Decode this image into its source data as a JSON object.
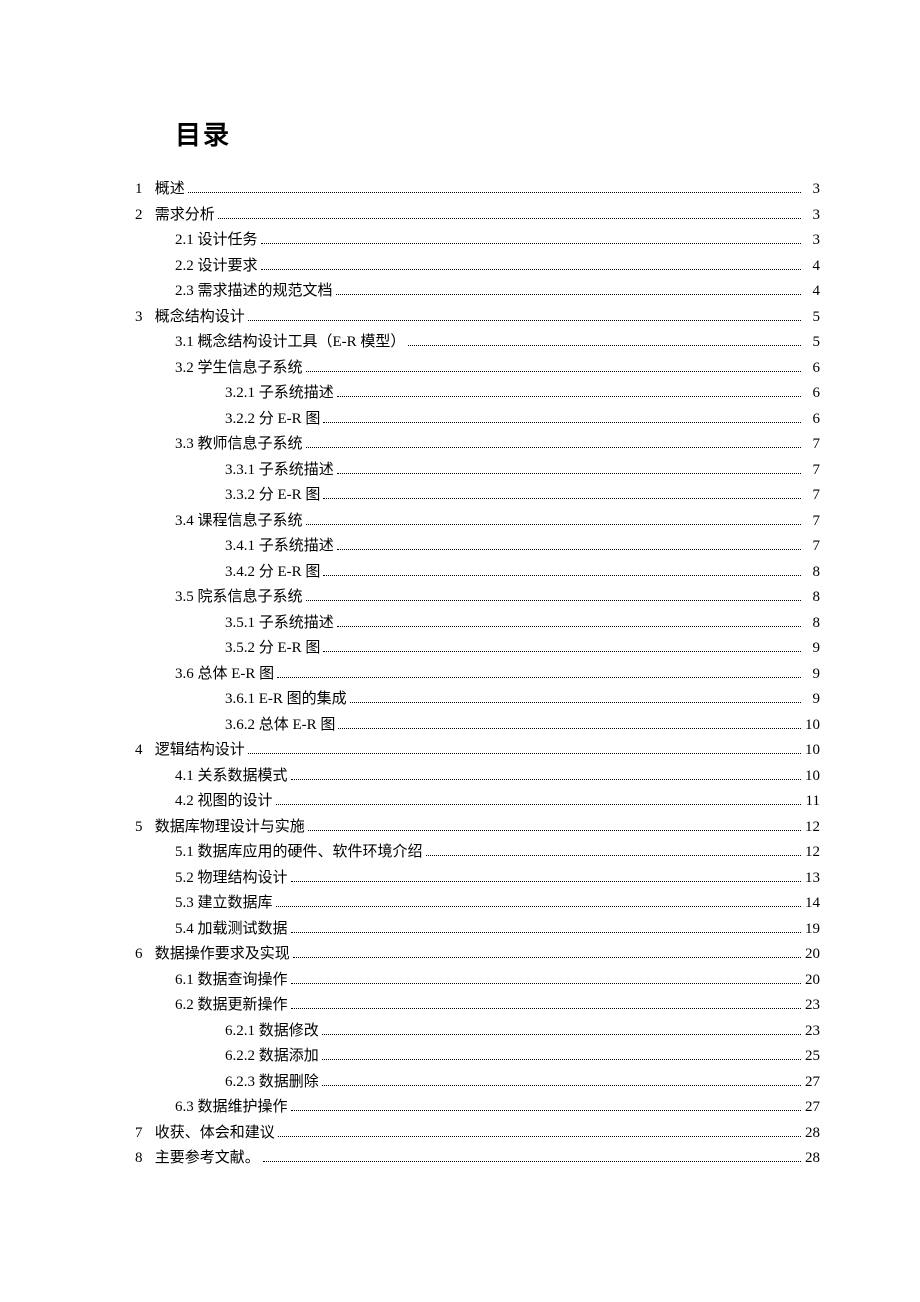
{
  "title": "目录",
  "toc": [
    {
      "level": 1,
      "num": "1",
      "sep": "  ",
      "text": "概述",
      "page": "3"
    },
    {
      "level": 1,
      "num": "2",
      "sep": "  ",
      "text": "需求分析",
      "page": "3"
    },
    {
      "level": 2,
      "num": "2.1",
      "sep": "  ",
      "text": "设计任务",
      "page": "3"
    },
    {
      "level": 2,
      "num": "2.2",
      "sep": "  ",
      "text": "设计要求",
      "page": "4"
    },
    {
      "level": 2,
      "num": "2.3",
      "sep": "  ",
      "text": "需求描述的规范文档",
      "page": "4"
    },
    {
      "level": 1,
      "num": "3",
      "sep": "  ",
      "text": "概念结构设计",
      "page": "5"
    },
    {
      "level": 2,
      "num": "3.1",
      "sep": "  ",
      "text": "概念结构设计工具（E-R 模型）",
      "page": "5"
    },
    {
      "level": 2,
      "num": "3.2",
      "sep": "  ",
      "text": "学生信息子系统",
      "page": "6"
    },
    {
      "level": 3,
      "num": "3.2.1",
      "sep": " ",
      "text": "子系统描述",
      "page": "6"
    },
    {
      "level": 3,
      "num": "3.2.2",
      "sep": " ",
      "text": "分 E-R 图",
      "page": "6"
    },
    {
      "level": 2,
      "num": "3.3",
      "sep": " ",
      "text": "教师信息子系统",
      "page": "7"
    },
    {
      "level": 3,
      "num": "3.3.1",
      "sep": " ",
      "text": "子系统描述",
      "page": "7"
    },
    {
      "level": 3,
      "num": "3.3.2",
      "sep": " ",
      "text": "分 E-R 图",
      "page": "7"
    },
    {
      "level": 2,
      "num": "3.4",
      "sep": "  ",
      "text": "课程信息子系统",
      "page": "7"
    },
    {
      "level": 3,
      "num": "3.4.1",
      "sep": " ",
      "text": "子系统描述",
      "page": "7"
    },
    {
      "level": 3,
      "num": "3.4.2",
      "sep": " ",
      "text": "分 E-R 图",
      "page": "8"
    },
    {
      "level": 2,
      "num": "3.5",
      "sep": "  ",
      "text": "院系信息子系统",
      "page": "8"
    },
    {
      "level": 3,
      "num": "3.5.1",
      "sep": " ",
      "text": "子系统描述",
      "page": "8"
    },
    {
      "level": 3,
      "num": "3.5.2",
      "sep": " ",
      "text": "分 E-R 图",
      "page": "9"
    },
    {
      "level": 2,
      "num": "3.6",
      "sep": "  ",
      "text": "总体 E-R 图",
      "page": "9"
    },
    {
      "level": 3,
      "num": "3.6.1",
      "sep": " ",
      "text": "E-R 图的集成",
      "page": "9"
    },
    {
      "level": 3,
      "num": "3.6.2",
      "sep": " ",
      "text": "总体 E-R 图",
      "page": "10"
    },
    {
      "level": 1,
      "num": "4",
      "sep": "  ",
      "text": "逻辑结构设计",
      "page": "10"
    },
    {
      "level": 2,
      "num": "4.1",
      "sep": "  ",
      "text": "关系数据模式",
      "page": "10"
    },
    {
      "level": 2,
      "num": "4.2",
      "sep": "  ",
      "text": "视图的设计",
      "page": "11"
    },
    {
      "level": 1,
      "num": "5",
      "sep": "  ",
      "text": "数据库物理设计与实施",
      "page": "12"
    },
    {
      "level": 2,
      "num": "5.1",
      "sep": "  ",
      "text": "数据库应用的硬件、软件环境介绍",
      "page": "12"
    },
    {
      "level": 2,
      "num": "5.2",
      "sep": "  ",
      "text": "物理结构设计",
      "page": "13"
    },
    {
      "level": 2,
      "num": "5.3",
      "sep": "  ",
      "text": "建立数据库",
      "page": "14"
    },
    {
      "level": 2,
      "num": "5.4",
      "sep": "  ",
      "text": "加载测试数据",
      "page": "19"
    },
    {
      "level": 1,
      "num": "6",
      "sep": "  ",
      "text": "数据操作要求及实现",
      "page": "20"
    },
    {
      "level": 2,
      "num": "6.1",
      "sep": "  ",
      "text": "数据查询操作",
      "page": "20"
    },
    {
      "level": 2,
      "num": "6.2",
      "sep": "  ",
      "text": "数据更新操作",
      "page": "23"
    },
    {
      "level": 3,
      "num": "6.2.1",
      "sep": "  ",
      "text": "数据修改",
      "page": "23"
    },
    {
      "level": 3,
      "num": "6.2.2",
      "sep": "  ",
      "text": "数据添加",
      "page": "25"
    },
    {
      "level": 3,
      "num": "6.2.3",
      "sep": "  ",
      "text": "数据删除",
      "page": "27"
    },
    {
      "level": 2,
      "num": "6.3",
      "sep": "  ",
      "text": "数据维护操作",
      "page": "27"
    },
    {
      "level": 1,
      "num": "7",
      "sep": "  ",
      "text": "收获、体会和建议",
      "page": "28"
    },
    {
      "level": 1,
      "num": "8",
      "sep": "  ",
      "text": "主要参考文献。",
      "page": "28"
    }
  ]
}
